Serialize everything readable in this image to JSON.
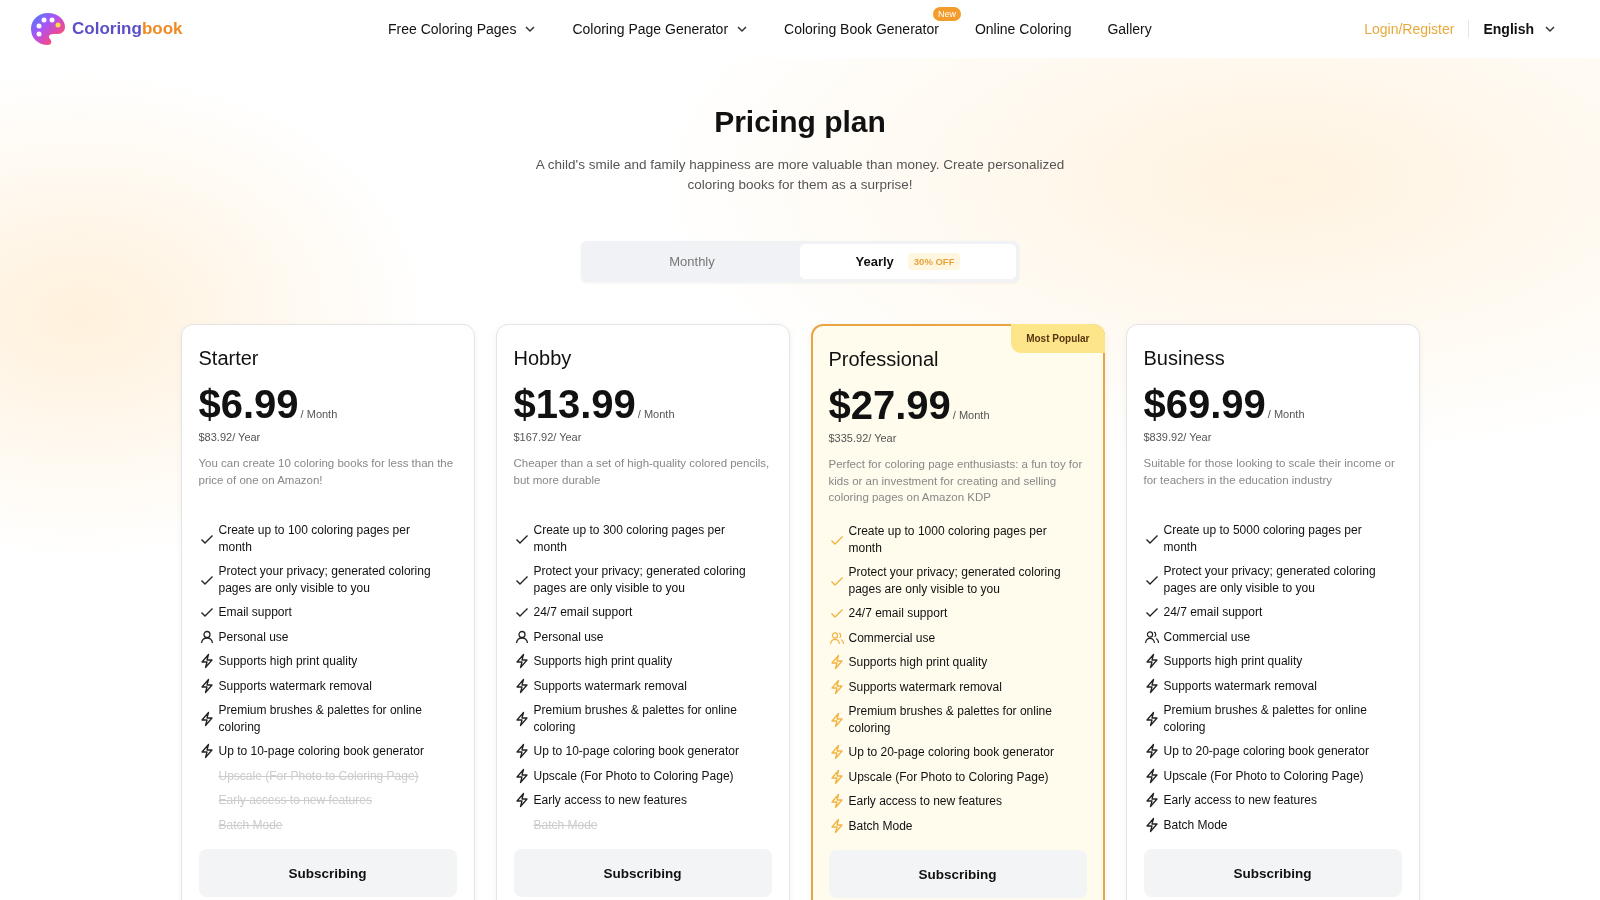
{
  "header": {
    "logo": {
      "text": "Coloring",
      "accent": "book"
    },
    "nav": [
      {
        "label": "Free Coloring Pages",
        "dropdown": true
      },
      {
        "label": "Coloring Page Generator",
        "dropdown": true
      },
      {
        "label": "Coloring Book Generator",
        "dropdown": false,
        "badge": "New"
      },
      {
        "label": "Online Coloring",
        "dropdown": false
      },
      {
        "label": "Gallery",
        "dropdown": false
      }
    ],
    "login": "Login/Register",
    "language": "English"
  },
  "title": "Pricing plan",
  "subtitle": "A child's smile and family happiness are more valuable than money. Create personalized coloring books for them as a surprise!",
  "billing_toggle": [
    {
      "label": "Monthly",
      "selected": false
    },
    {
      "label": "Yearly",
      "selected": true,
      "badge": "30% OFF"
    }
  ],
  "plans": [
    {
      "name": "Starter",
      "price": "$6.99",
      "period": "/ Month",
      "yearly": "$83.92/ Year",
      "description": "You can create 10 coloring books for less than the price of one on Amazon!",
      "highlighted": false,
      "features": [
        {
          "kind": "check",
          "text": "Create up to 100 coloring pages per month",
          "included": true
        },
        {
          "kind": "check",
          "text": "Protect your privacy; generated coloring pages are only visible to you",
          "included": true
        },
        {
          "kind": "check",
          "text": "Email support",
          "included": true
        },
        {
          "kind": "user",
          "text": "Personal use",
          "included": true
        },
        {
          "kind": "bolt",
          "text": "Supports high print quality",
          "included": true
        },
        {
          "kind": "bolt",
          "text": "Supports watermark removal",
          "included": true
        },
        {
          "kind": "bolt",
          "text": "Premium brushes & palettes for online coloring",
          "included": true
        },
        {
          "kind": "bolt",
          "text": "Up to 10-page coloring book generator",
          "included": true
        },
        {
          "text": "Upscale (For Photo to Coloring Page)",
          "included": false
        },
        {
          "text": "Early access to new features",
          "included": false
        },
        {
          "text": "Batch Mode",
          "included": false
        }
      ],
      "button": "Subscribing"
    },
    {
      "name": "Hobby",
      "price": "$13.99",
      "period": "/ Month",
      "yearly": "$167.92/ Year",
      "description": "Cheaper than a set of high-quality colored pencils, but more durable",
      "highlighted": false,
      "features": [
        {
          "kind": "check",
          "text": "Create up to 300 coloring pages per month",
          "included": true
        },
        {
          "kind": "check",
          "text": "Protect your privacy; generated coloring pages are only visible to you",
          "included": true
        },
        {
          "kind": "check",
          "text": "24/7 email support",
          "included": true
        },
        {
          "kind": "user",
          "text": "Personal use",
          "included": true
        },
        {
          "kind": "bolt",
          "text": "Supports high print quality",
          "included": true
        },
        {
          "kind": "bolt",
          "text": "Supports watermark removal",
          "included": true
        },
        {
          "kind": "bolt",
          "text": "Premium brushes & palettes for online coloring",
          "included": true
        },
        {
          "kind": "bolt",
          "text": "Up to 10-page coloring book generator",
          "included": true
        },
        {
          "kind": "bolt",
          "text": "Upscale (For Photo to Coloring Page)",
          "included": true
        },
        {
          "kind": "bolt",
          "text": "Early access to new features",
          "included": true
        },
        {
          "text": "Batch Mode",
          "included": false
        }
      ],
      "button": "Subscribing"
    },
    {
      "name": "Professional",
      "price": "$27.99",
      "period": "/ Month",
      "yearly": "$335.92/ Year",
      "description": "Perfect for coloring page enthusiasts: a fun toy for kids or an investment for creating and selling coloring pages on Amazon KDP",
      "highlighted": true,
      "badge": "Most Popular",
      "features": [
        {
          "kind": "check",
          "text": "Create up to 1000 coloring pages per month",
          "included": true
        },
        {
          "kind": "check",
          "text": "Protect your privacy; generated coloring pages are only visible to you",
          "included": true
        },
        {
          "kind": "check",
          "text": "24/7 email support",
          "included": true
        },
        {
          "kind": "users",
          "text": "Commercial use",
          "included": true
        },
        {
          "kind": "bolt",
          "text": "Supports high print quality",
          "included": true
        },
        {
          "kind": "bolt",
          "text": "Supports watermark removal",
          "included": true
        },
        {
          "kind": "bolt",
          "text": "Premium brushes & palettes for online coloring",
          "included": true
        },
        {
          "kind": "bolt",
          "text": "Up to 20-page coloring book generator",
          "included": true
        },
        {
          "kind": "bolt",
          "text": "Upscale (For Photo to Coloring Page)",
          "included": true
        },
        {
          "kind": "bolt",
          "text": "Early access to new features",
          "included": true
        },
        {
          "kind": "bolt",
          "text": "Batch Mode",
          "included": true
        }
      ],
      "button": "Subscribing"
    },
    {
      "name": "Business",
      "price": "$69.99",
      "period": "/ Month",
      "yearly": "$839.92/ Year",
      "description": "Suitable for those looking to scale their income or for teachers in the education industry",
      "highlighted": false,
      "features": [
        {
          "kind": "check",
          "text": "Create up to 5000 coloring pages per month",
          "included": true
        },
        {
          "kind": "check",
          "text": "Protect your privacy; generated coloring pages are only visible to you",
          "included": true
        },
        {
          "kind": "check",
          "text": "24/7 email support",
          "included": true
        },
        {
          "kind": "users",
          "text": "Commercial use",
          "included": true
        },
        {
          "kind": "bolt",
          "text": "Supports high print quality",
          "included": true
        },
        {
          "kind": "bolt",
          "text": "Supports watermark removal",
          "included": true
        },
        {
          "kind": "bolt",
          "text": "Premium brushes & palettes for online coloring",
          "included": true
        },
        {
          "kind": "bolt",
          "text": "Up to 20-page coloring book generator",
          "included": true
        },
        {
          "kind": "bolt",
          "text": "Upscale (For Photo to Coloring Page)",
          "included": true
        },
        {
          "kind": "bolt",
          "text": "Early access to new features",
          "included": true
        },
        {
          "kind": "bolt",
          "text": "Batch Mode",
          "included": true
        }
      ],
      "button": "Subscribing"
    }
  ]
}
